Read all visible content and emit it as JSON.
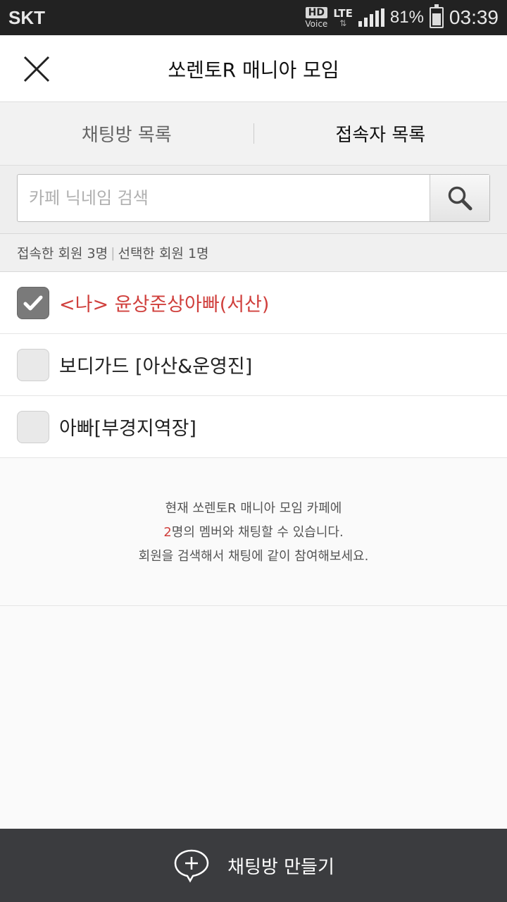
{
  "status": {
    "carrier": "SKT",
    "hd": "HD",
    "voice": "Voice",
    "network": "LTE",
    "battery": "81%",
    "battery_level": 0.81,
    "time": "03:39"
  },
  "header": {
    "title": "쏘렌토R 매니아 모임"
  },
  "tabs": [
    {
      "label": "채팅방 목록",
      "active": false
    },
    {
      "label": "접속자 목록",
      "active": true
    }
  ],
  "search": {
    "placeholder": "카페 닉네임 검색",
    "value": ""
  },
  "counts": {
    "connected": "접속한 회원 3명",
    "separator": "|",
    "selected": "선택한 회원 1명"
  },
  "members": [
    {
      "name": "<나> 윤상준상아빠(서산)",
      "checked": true,
      "is_self": true
    },
    {
      "name": "보디가드 [아산&운영진]",
      "checked": false,
      "is_self": false
    },
    {
      "name": "아빠[부경지역장]",
      "checked": false,
      "is_self": false
    }
  ],
  "info": {
    "line1": "현재 쏘렌토R 매니아 모임 카페에",
    "line2_count": "2",
    "line2_rest": "명의 멤버와 채팅할 수 있습니다.",
    "line3": "회원을 검색해서 채팅에 같이 참여해보세요."
  },
  "footer": {
    "create_label": "채팅방 만들기"
  },
  "colors": {
    "highlight": "#d0403d",
    "footer_bg": "#3b3c3f",
    "statusbar_bg": "#222222"
  }
}
